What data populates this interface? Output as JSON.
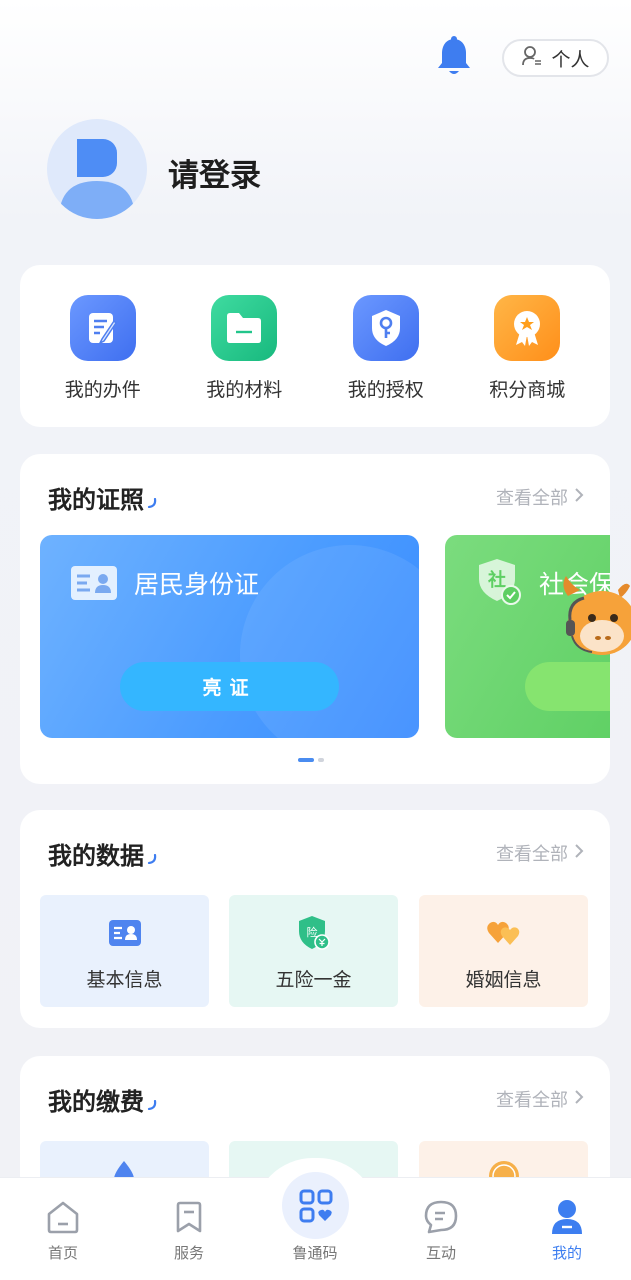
{
  "header": {
    "personal_label": "个人",
    "login_prompt": "请登录"
  },
  "quick_actions": [
    {
      "label": "我的办件",
      "icon": "edit-document-icon",
      "color": "#4f7ff0"
    },
    {
      "label": "我的材料",
      "icon": "folder-icon",
      "color": "#22c58b"
    },
    {
      "label": "我的授权",
      "icon": "key-shield-icon",
      "color": "#4f7ff0"
    },
    {
      "label": "积分商城",
      "icon": "award-ribbon-icon",
      "color": "#ff9f1c"
    }
  ],
  "licences": {
    "title": "我的证照",
    "view_all": "查看全部",
    "cards": [
      {
        "title": "居民身份证",
        "button": "亮证"
      },
      {
        "title": "社会保",
        "icon_text": "社"
      }
    ]
  },
  "data_section": {
    "title": "我的数据",
    "view_all": "查看全部",
    "tiles": [
      {
        "label": "基本信息",
        "bg": "#e9f1fd"
      },
      {
        "label": "五险一金",
        "badge": "险",
        "bg": "#e6f7f3"
      },
      {
        "label": "婚姻信息",
        "bg": "#fdf1e8"
      }
    ]
  },
  "fee_section": {
    "title": "我的缴费",
    "view_all": "查看全部"
  },
  "bottom_nav": [
    {
      "label": "首页",
      "icon": "home-icon"
    },
    {
      "label": "服务",
      "icon": "bookmark-icon"
    },
    {
      "label": "鲁通码",
      "icon": "qr-grid-icon"
    },
    {
      "label": "互动",
      "icon": "chat-icon"
    },
    {
      "label": "我的",
      "icon": "person-icon",
      "active": true
    }
  ],
  "colors": {
    "accent": "#4a8cf0",
    "active_nav": "#3d7ef0"
  }
}
